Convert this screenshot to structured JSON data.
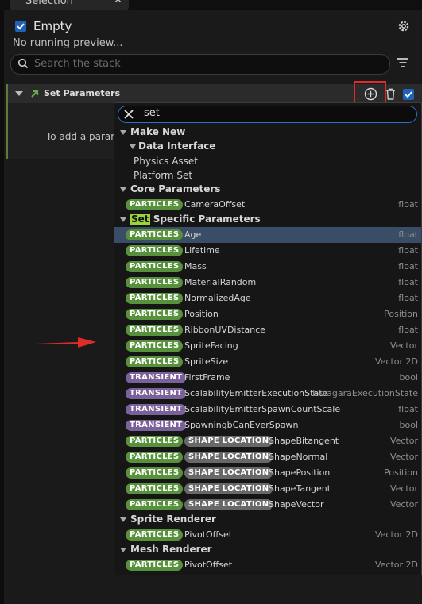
{
  "tab": {
    "title": "Selection"
  },
  "header": {
    "title": "Empty",
    "enabled": true,
    "preview_status": "No running preview..."
  },
  "stack_search": {
    "placeholder": "Search the stack"
  },
  "module": {
    "name": "Set Parameters",
    "body_hint": "To add a param"
  },
  "menu": {
    "search_value": "set",
    "make_new": {
      "label": "Make New",
      "data_interface": {
        "label": "Data Interface",
        "items": [
          "Physics Asset",
          "Platform Set"
        ]
      }
    },
    "core_parameters": {
      "label": "Core Parameters",
      "rows": [
        {
          "tags": [
            "PARTICLES"
          ],
          "name": "CameraOffset",
          "type": "float"
        }
      ]
    },
    "specific_parameters": {
      "label_highlight": "Set",
      "label_rest": " Specific Parameters",
      "rows": [
        {
          "tags": [
            "PARTICLES"
          ],
          "name": "Age",
          "type": "float",
          "selected": true
        },
        {
          "tags": [
            "PARTICLES"
          ],
          "name": "Lifetime",
          "type": "float"
        },
        {
          "tags": [
            "PARTICLES"
          ],
          "name": "Mass",
          "type": "float"
        },
        {
          "tags": [
            "PARTICLES"
          ],
          "name": "MaterialRandom",
          "type": "float"
        },
        {
          "tags": [
            "PARTICLES"
          ],
          "name": "NormalizedAge",
          "type": "float"
        },
        {
          "tags": [
            "PARTICLES"
          ],
          "name": "Position",
          "type": "Position"
        },
        {
          "tags": [
            "PARTICLES"
          ],
          "name": "RibbonUVDistance",
          "type": "float"
        },
        {
          "tags": [
            "PARTICLES"
          ],
          "name": "SpriteFacing",
          "type": "Vector"
        },
        {
          "tags": [
            "PARTICLES"
          ],
          "name": "SpriteSize",
          "type": "Vector 2D"
        },
        {
          "tags": [
            "TRANSIENT"
          ],
          "name": "FirstFrame",
          "type": "bool"
        },
        {
          "tags": [
            "TRANSIENT"
          ],
          "name": "ScalabilityEmitterExecutionState",
          "type": "ENiagaraExecutionState"
        },
        {
          "tags": [
            "TRANSIENT"
          ],
          "name": "ScalabilityEmitterSpawnCountScale",
          "type": "float"
        },
        {
          "tags": [
            "TRANSIENT"
          ],
          "name": "SpawningbCanEverSpawn",
          "type": "bool"
        },
        {
          "tags": [
            "PARTICLES",
            "SHAPE LOCATION"
          ],
          "name": "ShapeBitangent",
          "type": "Vector"
        },
        {
          "tags": [
            "PARTICLES",
            "SHAPE LOCATION"
          ],
          "name": "ShapeNormal",
          "type": "Vector"
        },
        {
          "tags": [
            "PARTICLES",
            "SHAPE LOCATION"
          ],
          "name": "ShapePosition",
          "type": "Position"
        },
        {
          "tags": [
            "PARTICLES",
            "SHAPE LOCATION"
          ],
          "name": "ShapeTangent",
          "type": "Vector"
        },
        {
          "tags": [
            "PARTICLES",
            "SHAPE LOCATION"
          ],
          "name": "ShapeVector",
          "type": "Vector"
        }
      ]
    },
    "sprite_renderer": {
      "label": "Sprite Renderer",
      "rows": [
        {
          "tags": [
            "PARTICLES"
          ],
          "name": "PivotOffset",
          "type": "Vector 2D"
        }
      ]
    },
    "mesh_renderer": {
      "label": "Mesh Renderer",
      "rows": [
        {
          "tags": [
            "PARTICLES"
          ],
          "name": "PivotOffset",
          "type": "Vector 2D"
        }
      ]
    }
  },
  "colors": {
    "particles": "#58913b",
    "transient": "#7a6199",
    "shape_location": "#686868",
    "selected_row": "#3a4d66",
    "highlight_box": "#e02b2b",
    "arrow": "#e02b2b",
    "match": "#9cd23a"
  }
}
